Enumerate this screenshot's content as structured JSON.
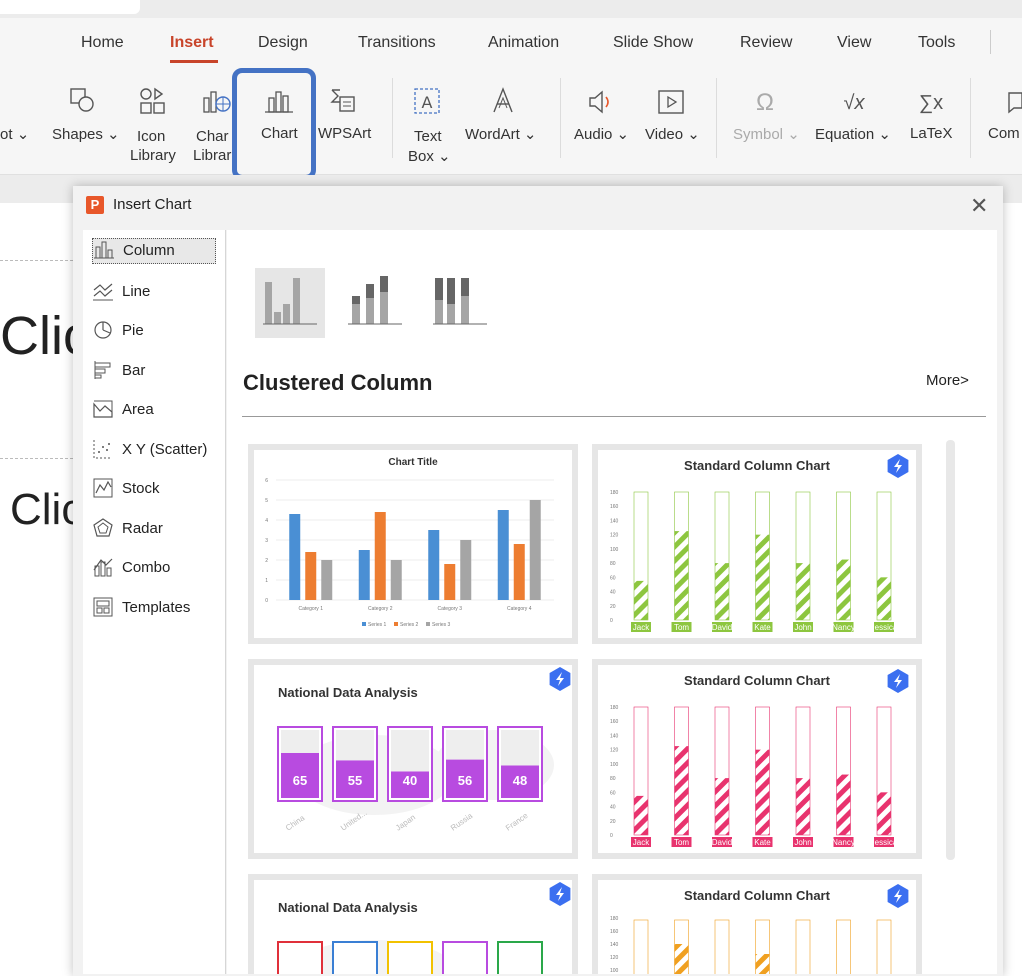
{
  "ribbon_tabs": [
    {
      "label": "Home"
    },
    {
      "label": "Insert"
    },
    {
      "label": "Design"
    },
    {
      "label": "Transitions"
    },
    {
      "label": "Animation"
    },
    {
      "label": "Slide Show"
    },
    {
      "label": "Review"
    },
    {
      "label": "View"
    },
    {
      "label": "Tools"
    }
  ],
  "ribbon": {
    "pic_partial": "ot",
    "shapes": "Shapes",
    "icon_library_1": "Icon",
    "icon_library_2": "Library",
    "chart_library_1": "Char",
    "chart_library_2": "Librar",
    "chart": "Chart",
    "wpsart": "WPSArt",
    "textbox_1": "Text",
    "textbox_2": "Box",
    "wordart": "WordArt",
    "audio": "Audio",
    "video": "Video",
    "symbol": "Symbol",
    "equation": "Equation",
    "latex": "LaTeX",
    "comment_partial": "Com",
    "dropdown_glyph": "⌄"
  },
  "slide": {
    "placeholder_1": "Clic",
    "placeholder_2": "Clic"
  },
  "dialog": {
    "app_icon": "P",
    "title": "Insert Chart",
    "close": "✕",
    "sidebar": [
      {
        "label": "Column"
      },
      {
        "label": "Line"
      },
      {
        "label": "Pie"
      },
      {
        "label": "Bar"
      },
      {
        "label": "Area"
      },
      {
        "label": "X Y (Scatter)"
      },
      {
        "label": "Stock"
      },
      {
        "label": "Radar"
      },
      {
        "label": "Combo"
      },
      {
        "label": "Templates"
      }
    ],
    "heading": "Clustered Column",
    "more": "More>",
    "cards": {
      "c1_title": "Chart Title",
      "c2_title": "Standard Column Chart",
      "c3_title": "National Data Analysis",
      "c4_title": "Standard Column Chart",
      "c5_title": "National Data Analysis",
      "c6_title": "Standard Column Chart"
    }
  },
  "chart_data": [
    {
      "type": "bar",
      "title": "Chart Title",
      "categories": [
        "Category 1",
        "Category 2",
        "Category 3",
        "Category 4"
      ],
      "series": [
        {
          "name": "Series 1",
          "values": [
            4.3,
            2.5,
            3.5,
            4.5
          ],
          "color": "#4a8fd4"
        },
        {
          "name": "Series 2",
          "values": [
            2.4,
            4.4,
            1.8,
            2.8
          ],
          "color": "#ed7d31"
        },
        {
          "name": "Series 3",
          "values": [
            2,
            2,
            3,
            5
          ],
          "color": "#a5a5a5"
        }
      ],
      "yticks": [
        "0",
        "1",
        "2",
        "3",
        "4",
        "5",
        "6"
      ],
      "ylim": [
        0,
        6
      ]
    },
    {
      "type": "bar",
      "title": "Standard Column Chart",
      "categories": [
        "Jack",
        "Tom",
        "David",
        "Kate",
        "John",
        "Nancy",
        "Jessica"
      ],
      "values": [
        55,
        125,
        80,
        120,
        80,
        85,
        60
      ],
      "yticks": [
        "0",
        "20",
        "40",
        "60",
        "80",
        "100",
        "120",
        "140",
        "160",
        "180"
      ],
      "ylim": [
        0,
        180
      ],
      "color": "#8dc63f"
    },
    {
      "type": "bar",
      "title": "National Data Analysis",
      "categories": [
        "China",
        "United...",
        "Japan",
        "Russia",
        "France"
      ],
      "values": [
        65,
        55,
        40,
        56,
        48
      ],
      "color": "#b84be0"
    },
    {
      "type": "bar",
      "title": "Standard Column Chart",
      "categories": [
        "Jack",
        "Tom",
        "David",
        "Kate",
        "John",
        "Nancy",
        "Jessica"
      ],
      "values": [
        55,
        125,
        80,
        120,
        80,
        85,
        60
      ],
      "yticks": [
        "0",
        "20",
        "40",
        "60",
        "80",
        "100",
        "120",
        "140",
        "160",
        "180"
      ],
      "ylim": [
        0,
        180
      ],
      "color": "#e8336e"
    },
    {
      "type": "bar",
      "title": "National Data Analysis",
      "categories": [],
      "values": [],
      "colors": [
        "#e0303a",
        "#3a7fd4",
        "#f2c200",
        "#b84be0",
        "#2aa84a"
      ]
    },
    {
      "type": "bar",
      "title": "Standard Column Chart",
      "categories": [],
      "values": [],
      "yticks": [
        "180",
        "160",
        "140",
        "120",
        "100"
      ],
      "color": "#f0a020"
    }
  ]
}
